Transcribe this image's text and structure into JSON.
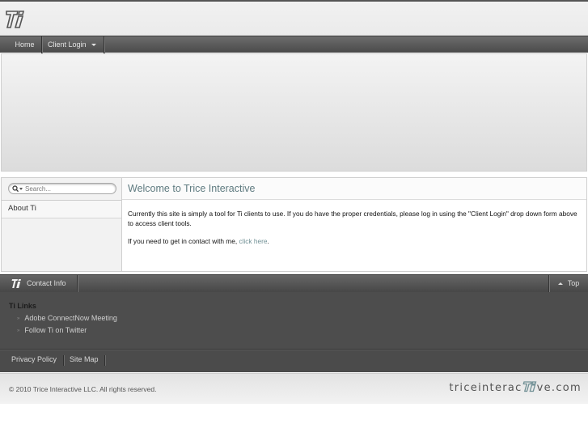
{
  "header": {
    "logo_text": "Ti"
  },
  "nav": {
    "home": "Home",
    "client_login": "Client Login"
  },
  "sidebar": {
    "search_placeholder": "Search...",
    "items": [
      {
        "label": "About Ti"
      }
    ]
  },
  "main": {
    "title": "Welcome to Trice Interactive",
    "paragraph1": "Currently this site is simply a tool for Ti clients to use. If you do have the proper credentials, please log in using the \"Client Login\" drop down form above to access client tools.",
    "paragraph2_prefix": "If you need to get in contact with me, ",
    "paragraph2_link": "click here",
    "paragraph2_suffix": "."
  },
  "footer": {
    "contact_label": "Contact Info",
    "top_label": "Top",
    "links_title": "Ti Links",
    "links": [
      {
        "label": "Adobe ConnectNow Meeting"
      },
      {
        "label": "Follow Ti on Twitter"
      }
    ],
    "bottom_nav": {
      "privacy": "Privacy Policy",
      "sitemap": "Site Map"
    },
    "copyright": "© 2010 Trice Interactive LLC. All rights reserved.",
    "brand_prefix": "triceinterac",
    "brand_suffix": "ve.com"
  },
  "colors": {
    "accent": "#6f8f94",
    "title": "#5f7b80",
    "footer_dark": "#4d4d4d",
    "nav_dark": "#4a4a4a"
  }
}
